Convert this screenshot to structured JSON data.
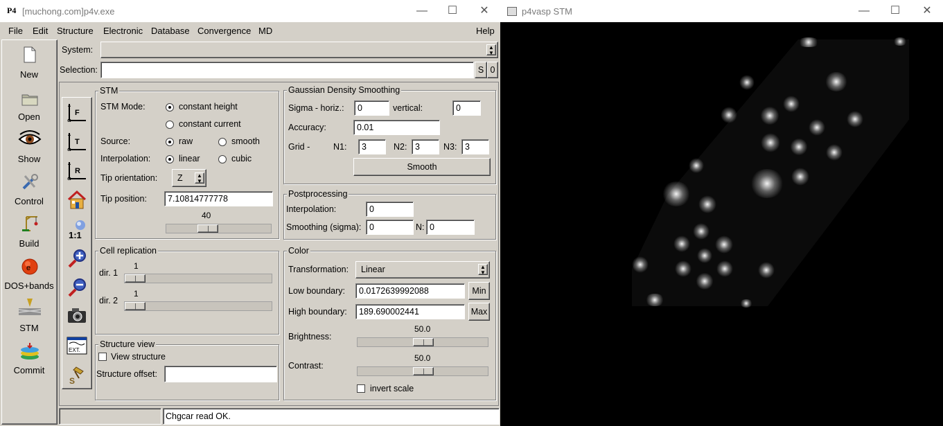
{
  "main_window": {
    "title": "[muchong.com]p4v.exe",
    "logo": "P4",
    "menu": [
      "File",
      "Edit",
      "Structure",
      "Electronic",
      "Database",
      "Convergence",
      "MD"
    ],
    "help": "Help",
    "system_label": "System:",
    "system_value": "",
    "selection_label": "Selection:",
    "selection_value": "",
    "sel_s": "S",
    "sel_0": "0",
    "sidebar": [
      {
        "label": "New",
        "icon": "new-document-icon"
      },
      {
        "label": "Open",
        "icon": "folder-icon"
      },
      {
        "label": "Show",
        "icon": "eye-icon"
      },
      {
        "label": "Control",
        "icon": "tools-icon"
      },
      {
        "label": "Build",
        "icon": "crane-icon"
      },
      {
        "label": "DOS+bands",
        "icon": "electron-icon"
      },
      {
        "label": "STM",
        "icon": "stm-icon"
      },
      {
        "label": "Commit",
        "icon": "database-icon"
      }
    ],
    "toolbar_icons": [
      "view-xf-icon",
      "view-yt-icon",
      "view-zr-icon",
      "home-icon",
      "scale-1-1-icon",
      "zoom-in-icon",
      "zoom-out-icon",
      "camera-icon",
      "ext-icon",
      "pin-icon"
    ],
    "toolbar_text": {
      "f": "F",
      "t": "T",
      "r": "R",
      "ext": "EXT.",
      "scale": "1:1"
    },
    "stm": {
      "title": "STM",
      "mode_label": "STM Mode:",
      "mode_opt1": "constant height",
      "mode_opt2": "constant current",
      "mode_selected": 1,
      "source_label": "Source:",
      "source_opt1": "raw",
      "source_opt2": "smooth",
      "source_selected": 1,
      "interp_label": "Interpolation:",
      "interp_opt1": "linear",
      "interp_opt2": "cubic",
      "interp_selected": 1,
      "tip_orient_label": "Tip orientation:",
      "tip_orient_value": "Z",
      "tip_pos_label": "Tip position:",
      "tip_pos_value": "7.10814777778",
      "slider_value": "40",
      "slider_fraction": 0.36
    },
    "gds": {
      "title": "Gaussian Density Smoothing",
      "sigma_label": "Sigma - horiz.:",
      "sigma_h": "0",
      "vertical_label": "vertical:",
      "sigma_v": "0",
      "accuracy_label": "Accuracy:",
      "accuracy": "0.01",
      "grid_label": "Grid -",
      "n1_label": "N1:",
      "n1": "3",
      "n2_label": "N2:",
      "n2": "3",
      "n3_label": "N3:",
      "n3": "3",
      "smooth_button": "Smooth"
    },
    "post": {
      "title": "Postprocessing",
      "interp_label": "Interpolation:",
      "interp_value": "0",
      "smoothing_label": "Smoothing (sigma):",
      "smoothing_value": "0",
      "n_label": "N:",
      "n_value": "0"
    },
    "cell": {
      "title": "Cell replication",
      "dir1_label": "dir. 1",
      "dir1_value": "1",
      "dir2_label": "dir. 2",
      "dir2_value": "1"
    },
    "color": {
      "title": "Color",
      "transform_label": "Transformation:",
      "transform_value": "Linear",
      "low_label": "Low boundary:",
      "low_value": "0.0172639992088",
      "min_button": "Min",
      "high_label": "High boundary:",
      "high_value": "189.690002441",
      "max_button": "Max",
      "brightness_label": "Brightness:",
      "brightness_value": "50.0",
      "contrast_label": "Contrast:",
      "contrast_value": "50.0",
      "invert_label": "invert scale"
    },
    "structure_view": {
      "title": "Structure view",
      "view_label": "View structure",
      "offset_label": "Structure offset:",
      "offset_value": ""
    },
    "status": "Chgcar read OK."
  },
  "stm_window": {
    "title": "p4vasp STM",
    "background": "#000000"
  },
  "window_buttons": {
    "minimize": "—",
    "maximize": "☐",
    "close": "✕"
  }
}
